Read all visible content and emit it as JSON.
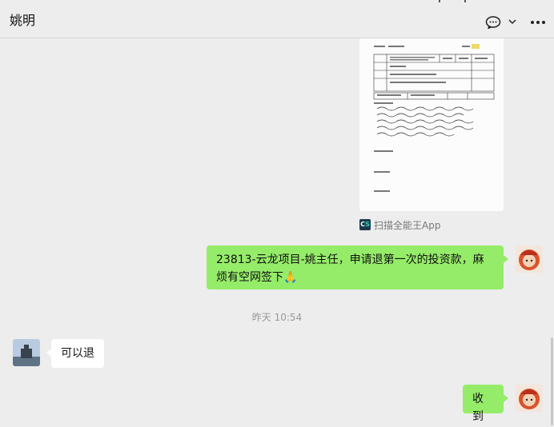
{
  "header": {
    "title": "姚明"
  },
  "messages": {
    "image_source_label": "扫描全能王App",
    "msg1_text": "23813-云龙项目-姚主任，申请退第一次的投资款，麻烦有空网签下",
    "msg1_emoji": "🙏",
    "timestamp": "昨天 10:54",
    "msg2_text": "可以退",
    "msg3_text": "收到"
  },
  "icons": {
    "chat": "chat-bubble-icon",
    "dropdown": "chevron-down-icon",
    "more": "more-icon",
    "scanner_app": "camscanner-icon"
  },
  "colors": {
    "background": "#ededed",
    "sent_bubble": "#95ec69",
    "received_bubble": "#ffffff"
  }
}
